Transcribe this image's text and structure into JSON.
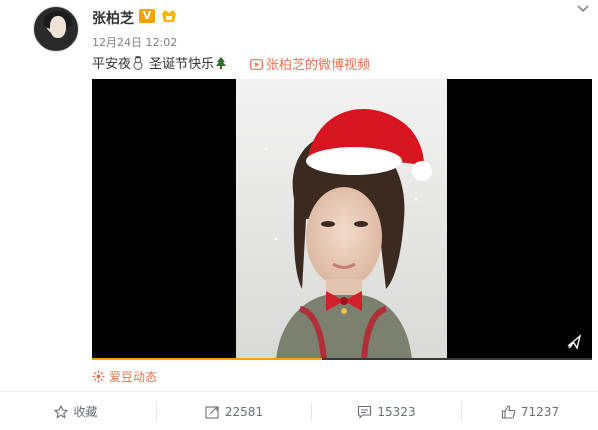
{
  "post": {
    "author": "张柏芝",
    "time": "12月24日 12:02",
    "text_part1": "平安夜",
    "text_part2": "圣诞节快乐",
    "video_link": "张柏芝的微博视频",
    "idol_tag": "爱豆动态"
  },
  "video": {
    "progress": 0.46
  },
  "actions": {
    "favorite": "收藏",
    "repost": "22581",
    "comment": "15323",
    "like": "71237"
  },
  "colors": {
    "accent": "#eb7350",
    "verified": "#f5a200",
    "progress": "#f5a200",
    "action_text": "#696e78"
  },
  "icons": [
    "snowman-icon",
    "christmas-tree-icon",
    "video-icon",
    "star-icon",
    "repost-icon",
    "comment-icon",
    "like-icon",
    "mini-player-icon",
    "chevron-down-icon"
  ]
}
